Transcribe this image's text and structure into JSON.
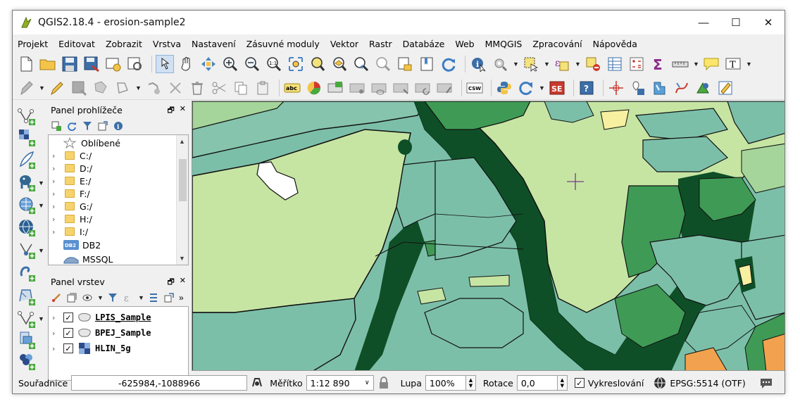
{
  "window": {
    "title": "QGIS2.18.4 - erosion-sample2",
    "controls": {
      "minimize": "—",
      "maximize": "☐",
      "close": "✕"
    }
  },
  "menu": [
    "Projekt",
    "Editovat",
    "Zobrazit",
    "Vrstva",
    "Nastavení",
    "Zásuvné moduly",
    "Vektor",
    "Rastr",
    "Databáze",
    "Web",
    "MMQGIS",
    "Zpracování",
    "Nápověda"
  ],
  "browser_panel": {
    "title": "Panel prohlížeče",
    "items": [
      {
        "label": "Oblíbené",
        "type": "favorites"
      },
      {
        "label": "C:/",
        "type": "folder"
      },
      {
        "label": "D:/",
        "type": "folder"
      },
      {
        "label": "E:/",
        "type": "folder"
      },
      {
        "label": "F:/",
        "type": "folder"
      },
      {
        "label": "G:/",
        "type": "folder"
      },
      {
        "label": "H:/",
        "type": "folder"
      },
      {
        "label": "I:/",
        "type": "folder"
      },
      {
        "label": "DB2",
        "type": "db2"
      },
      {
        "label": "MSSQL",
        "type": "mssql"
      }
    ]
  },
  "layers_panel": {
    "title": "Panel vrstev",
    "layers": [
      {
        "name": "LPIS_Sample",
        "checked": true,
        "kind": "vector-polygon",
        "underlined": true
      },
      {
        "name": "BPEJ_Sample",
        "checked": true,
        "kind": "vector-polygon",
        "underlined": false
      },
      {
        "name": "HLIN_5g",
        "checked": true,
        "kind": "raster",
        "underlined": false
      }
    ]
  },
  "statusbar": {
    "coord_label": "Souřadnice",
    "coord_value": "-625984,-1088966",
    "scale_label": "Měřítko",
    "scale_value": "1:12 890",
    "magnifier_label": "Lupa",
    "magnifier_value": "100%",
    "rotation_label": "Rotace",
    "rotation_value": "0,0",
    "render_label": "Vykreslování",
    "render_checked": true,
    "crs": "EPSG:5514 (OTF)"
  },
  "toolbar1_text": {
    "text_annotation": "T"
  },
  "toolbar2_text": {
    "label_abc": "abc",
    "csw": "CSW",
    "se": "SE",
    "help": "?"
  },
  "map_colors": {
    "water_bg": "#7cbfa9",
    "light_green": "#c6e5a3",
    "mid_green": "#3f9a55",
    "dark_green": "#0f4f27",
    "forest_green": "#2e8b4a",
    "yellow": "#f7f0a0",
    "orange": "#f2a24e"
  }
}
